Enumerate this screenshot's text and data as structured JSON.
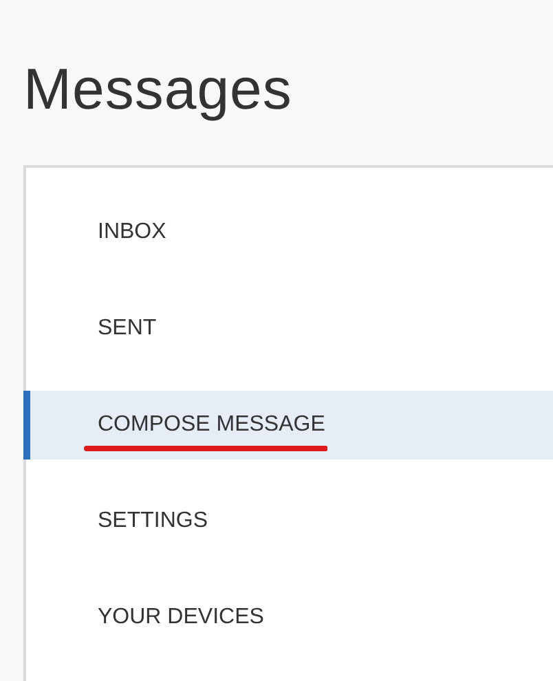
{
  "page_title": "Messages",
  "nav_items": [
    {
      "label": "INBOX",
      "selected": false,
      "underlined": false
    },
    {
      "label": "SENT",
      "selected": false,
      "underlined": false
    },
    {
      "label": "COMPOSE MESSAGE",
      "selected": true,
      "underlined": true
    },
    {
      "label": "SETTINGS",
      "selected": false,
      "underlined": false
    },
    {
      "label": "YOUR DEVICES",
      "selected": false,
      "underlined": false
    }
  ]
}
